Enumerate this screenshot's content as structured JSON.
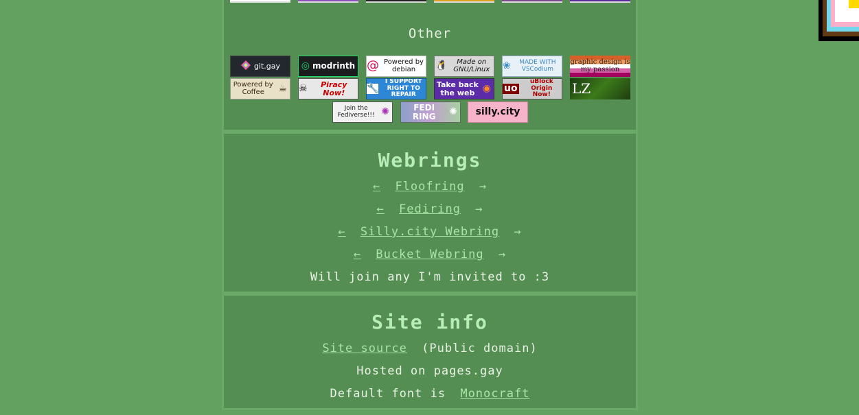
{
  "buttons_section": {
    "heading": "Other",
    "badges": [
      {
        "label": "git.gay",
        "icon": "git-gay-icon"
      },
      {
        "label": "modrinth",
        "icon": "modrinth-icon"
      },
      {
        "label": "Powered by debian",
        "icon": "debian-icon"
      },
      {
        "label": "Made on GNU/Linux",
        "icon": "tux-icon"
      },
      {
        "label": "MADE WITH VSCodium",
        "icon": "vscodium-icon"
      },
      {
        "label": "graphic design is my passion",
        "icon": ""
      },
      {
        "label": "Powered by Coffee",
        "icon": "coffee-icon"
      },
      {
        "label": "Piracy Now!",
        "icon": "skull-icon"
      },
      {
        "label": "I SUPPORT RIGHT TO REPAIR",
        "icon": "wrench-icon"
      },
      {
        "label": "Take back the web",
        "icon": "firefox-icon"
      },
      {
        "label": "uBlock Origin Now!",
        "icon": "ublock-icon"
      },
      {
        "label": "LZ",
        "icon": ""
      },
      {
        "label": "Join the Fediverse!!!",
        "icon": "fediverse-icon"
      },
      {
        "label": "FEDI RING",
        "icon": "fediring-icon"
      },
      {
        "label": "silly.city",
        "icon": ""
      }
    ]
  },
  "webrings": {
    "heading": "Webrings",
    "prev_arrow": "←",
    "next_arrow": "→",
    "rings": [
      {
        "name": "Floofring"
      },
      {
        "name": "Fediring"
      },
      {
        "name": "Silly.city Webring"
      },
      {
        "name": "Bucket Webring"
      }
    ],
    "note": "Will join any I'm invited to :3"
  },
  "site_info": {
    "heading": "Site info",
    "source_link": "Site source",
    "source_suffix": "(Public domain)",
    "hosted": "Hosted on pages.gay",
    "font_prefix": "Default font is",
    "font_link": "Monocraft"
  }
}
